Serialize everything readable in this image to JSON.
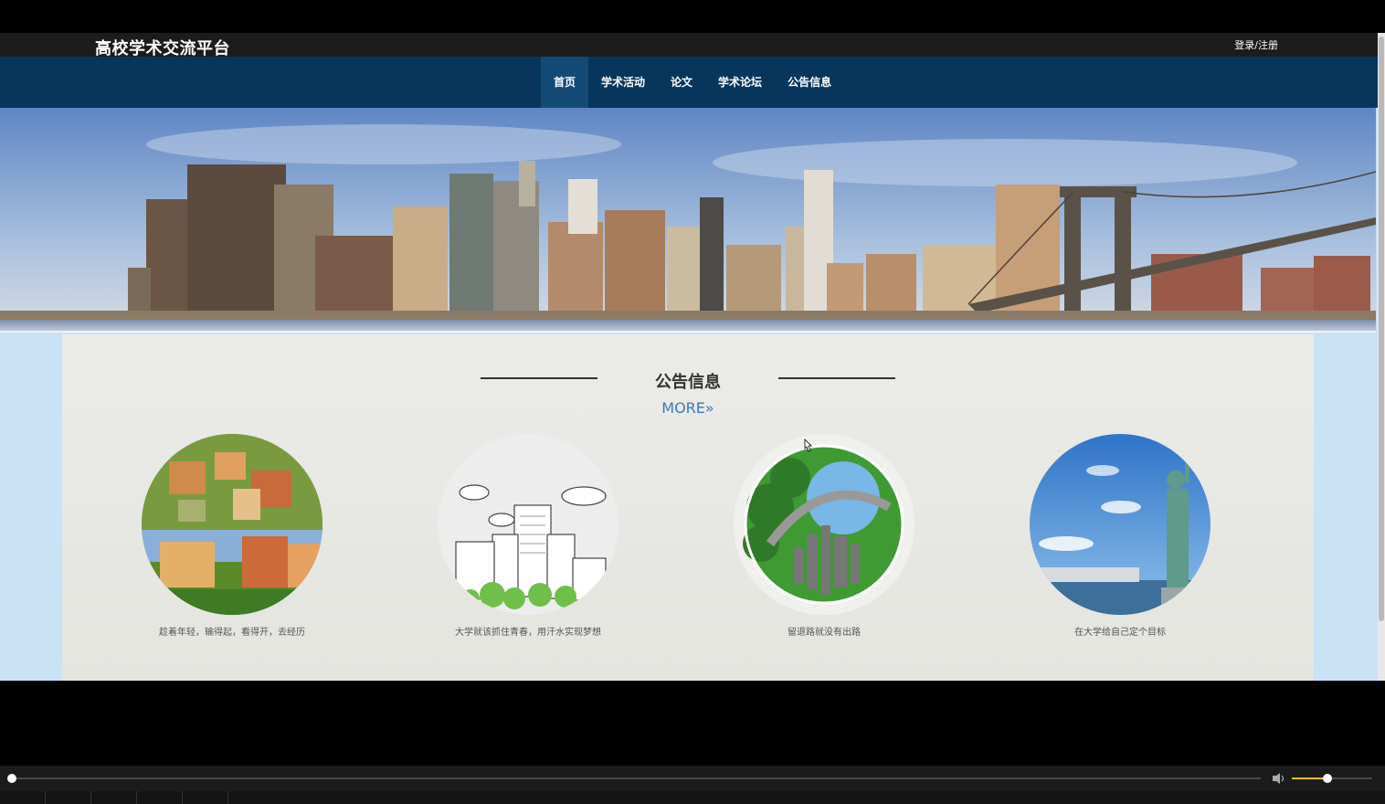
{
  "header": {
    "site_title": "高校学术交流平台",
    "login_label": "登录/注册"
  },
  "nav": {
    "items": [
      {
        "label": "首页",
        "active": true
      },
      {
        "label": "学术活动",
        "active": false
      },
      {
        "label": "论文",
        "active": false
      },
      {
        "label": "学术论坛",
        "active": false
      },
      {
        "label": "公告信息",
        "active": false
      }
    ]
  },
  "section": {
    "title": "公告信息",
    "more_label": "MORE»"
  },
  "cards": [
    {
      "caption": "趁着年轻，输得起，看得开，去经历",
      "icon": "campus-buildings-image"
    },
    {
      "caption": "大学就该抓住青春，用汗水实现梦想",
      "icon": "city-sketch-image"
    },
    {
      "caption": "留退路就没有出路",
      "icon": "green-planet-city-image"
    },
    {
      "caption": "在大学给自己定个目标",
      "icon": "statue-of-liberty-image"
    }
  ],
  "colors": {
    "topbar": "#1c1c1c",
    "navbar": "#07355b",
    "nav_active": "#134a75",
    "more_link": "#3a7bbf",
    "volume_fill": "#f0c020"
  },
  "player": {
    "progress": 0.0,
    "volume": 0.45
  }
}
